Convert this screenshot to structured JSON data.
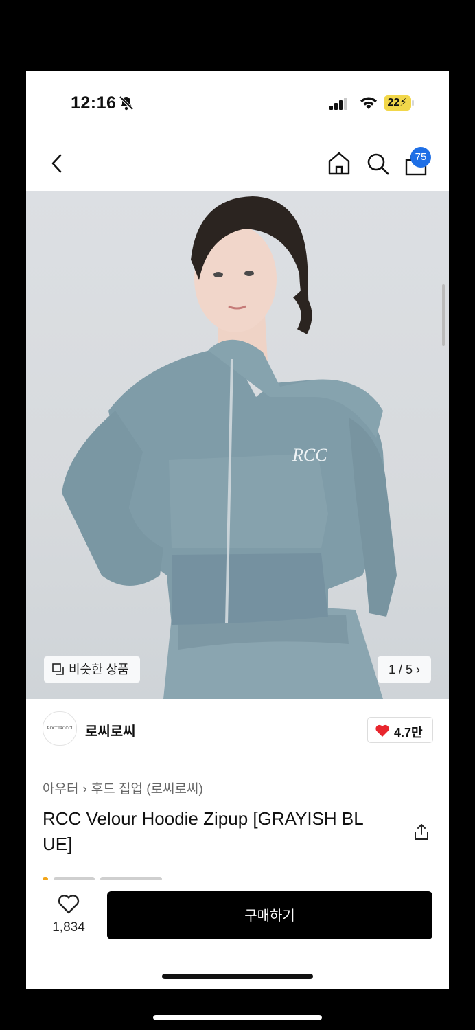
{
  "status_bar": {
    "time": "12:16",
    "battery": "22"
  },
  "nav": {
    "cart_count": "75"
  },
  "hero": {
    "similar_label": "비슷한 상품",
    "pager": "1 / 5 ›",
    "logo_text": "RCC"
  },
  "brand": {
    "name": "로씨로씨",
    "logo_text": "ROCCIROCCI",
    "likes": "4.7만"
  },
  "category": {
    "parent": "아우터",
    "child": "후드 집업 (로씨로씨)"
  },
  "product": {
    "title": "RCC Velour Hoodie Zipup [GRAYISH BL UE]"
  },
  "bottom_bar": {
    "wish_count": "1,834",
    "buy_label": "구매하기"
  },
  "colors": {
    "accent": "#1e6fe6",
    "heart": "#e8262e",
    "battery": "#f2d74a",
    "jacket": "#7f9ca8"
  }
}
